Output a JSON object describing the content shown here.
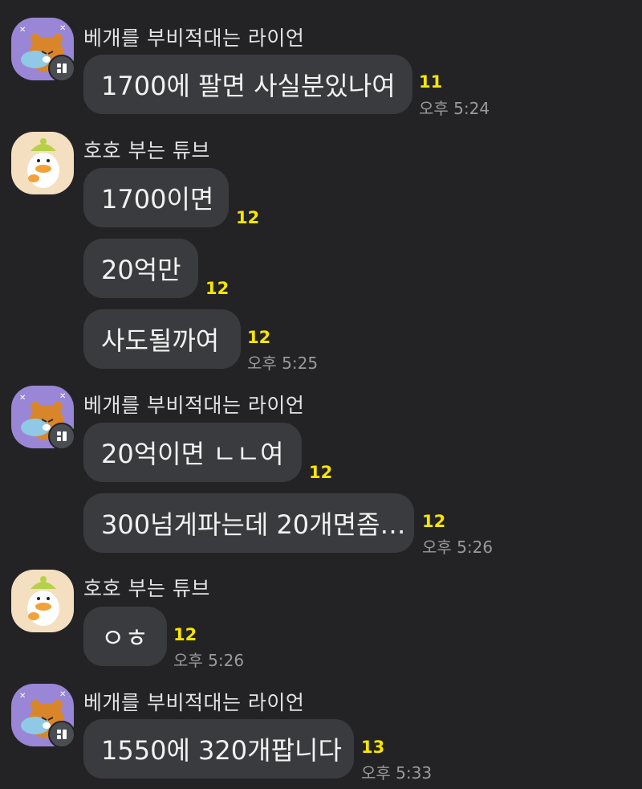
{
  "senders": {
    "lion": "베개를 부비적대는 라이언",
    "tube": "호호 부는 튜브"
  },
  "messages": [
    {
      "text": "1700에 팔면 사실분있나여",
      "unread": "11",
      "time": "오후 5:24"
    },
    {
      "text": "1700이면",
      "unread": "12",
      "time": ""
    },
    {
      "text": "20억만",
      "unread": "12",
      "time": ""
    },
    {
      "text": "사도될까여",
      "unread": "12",
      "time": "오후 5:25"
    },
    {
      "text": "20억이면 ㄴㄴ여",
      "unread": "12",
      "time": ""
    },
    {
      "text": "300넘게파는데 20개면좀…",
      "unread": "12",
      "time": "오후 5:26"
    },
    {
      "text": "ㅇㅎ",
      "unread": "12",
      "time": "오후 5:26"
    },
    {
      "text": "1550에 320개팝니다",
      "unread": "13",
      "time": "오후 5:33"
    }
  ],
  "colors": {
    "background": "#232325",
    "bubble": "#3a3b3e",
    "unread": "#f7e600",
    "time": "#9a9a9a",
    "lion_avatar_bg": "#9a86d6",
    "tube_avatar_bg": "#f4dfc0"
  },
  "icons": {
    "lion_avatar": "lion-character-icon",
    "tube_avatar": "tube-duck-character-icon",
    "badge": "chat-badge-icon"
  }
}
